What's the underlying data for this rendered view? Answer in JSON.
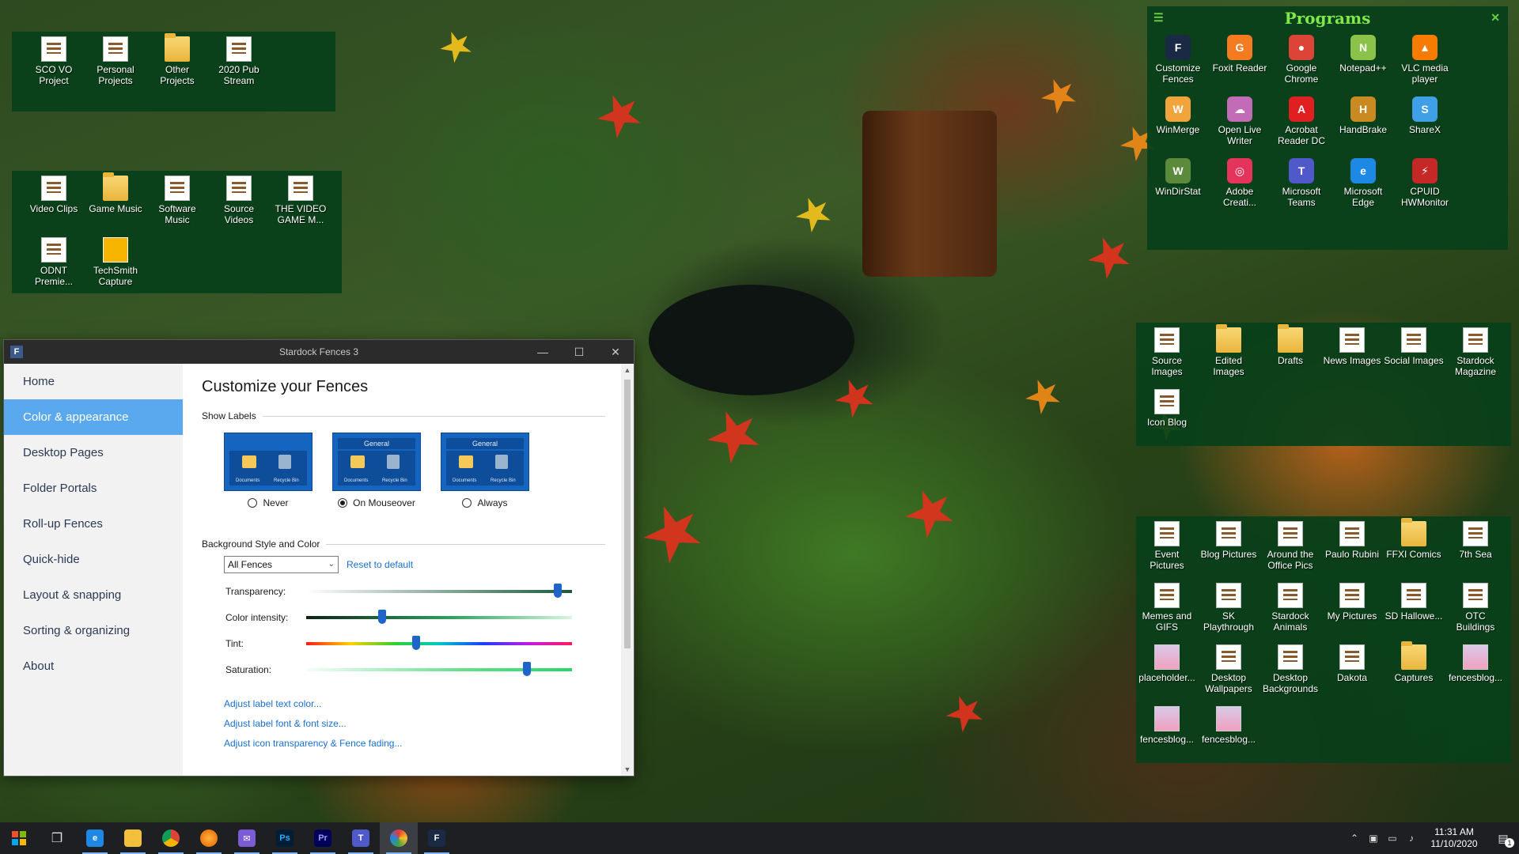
{
  "fences": {
    "top_left": [
      {
        "label": "SCO VO Project",
        "icon": "doc"
      },
      {
        "label": "Personal Projects",
        "icon": "doc"
      },
      {
        "label": "Other Projects",
        "icon": "folder"
      },
      {
        "label": "2020 Pub Stream",
        "icon": "doc"
      }
    ],
    "media": [
      {
        "label": "Video Clips",
        "icon": "doc"
      },
      {
        "label": "Game Music",
        "icon": "folder"
      },
      {
        "label": "Software Music",
        "icon": "doc"
      },
      {
        "label": "Source Videos",
        "icon": "doc"
      },
      {
        "label": "THE VIDEO GAME M...",
        "icon": "doc"
      },
      {
        "label": "ODNT Premie...",
        "icon": "doc"
      },
      {
        "label": "TechSmith Capture",
        "icon": "techsmith"
      }
    ],
    "programs": {
      "title": "Programs",
      "items": [
        {
          "label": "Customize Fences",
          "icon": "fences",
          "color": "#1b2a44",
          "glyph": "F"
        },
        {
          "label": "Foxit Reader",
          "icon": "foxit",
          "color": "#f47b20",
          "glyph": "G"
        },
        {
          "label": "Google Chrome",
          "icon": "chrome",
          "color": "#db4437",
          "glyph": "●"
        },
        {
          "label": "Notepad++",
          "icon": "notepad",
          "color": "#8bc34a",
          "glyph": "N"
        },
        {
          "label": "VLC media player",
          "icon": "vlc",
          "color": "#f57c00",
          "glyph": "▲"
        },
        {
          "label": "WinMerge",
          "icon": "winmerge",
          "color": "#f2a43c",
          "glyph": "W"
        },
        {
          "label": "Open Live Writer",
          "icon": "olw",
          "color": "#c26cb7",
          "glyph": "☁"
        },
        {
          "label": "Acrobat Reader DC",
          "icon": "acrobat",
          "color": "#e02020",
          "glyph": "A"
        },
        {
          "label": "HandBrake",
          "icon": "handbrake",
          "color": "#c98a22",
          "glyph": "H"
        },
        {
          "label": "ShareX",
          "icon": "sharex",
          "color": "#3fa0e8",
          "glyph": "S"
        },
        {
          "label": "WinDirStat",
          "icon": "windirstat",
          "color": "#5a8a3a",
          "glyph": "W"
        },
        {
          "label": "Adobe Creati...",
          "icon": "adobe-cc",
          "color": "#e5345b",
          "glyph": "◎"
        },
        {
          "label": "Microsoft Teams",
          "icon": "teams",
          "color": "#5059c9",
          "glyph": "T"
        },
        {
          "label": "Microsoft Edge",
          "icon": "edge",
          "color": "#1e88e5",
          "glyph": "e"
        },
        {
          "label": "CPUID HWMonitor",
          "icon": "hwmonitor",
          "color": "#c62828",
          "glyph": "⚡"
        }
      ]
    },
    "images": [
      {
        "label": "Source Images",
        "icon": "doc"
      },
      {
        "label": "Edited Images",
        "icon": "folder"
      },
      {
        "label": "Drafts",
        "icon": "folder"
      },
      {
        "label": "News Images",
        "icon": "doc"
      },
      {
        "label": "Social Images",
        "icon": "doc"
      },
      {
        "label": "Stardock Magazine",
        "icon": "doc"
      },
      {
        "label": "Icon Blog",
        "icon": "doc"
      }
    ],
    "pictures": [
      {
        "label": "Event Pictures",
        "icon": "doc"
      },
      {
        "label": "Blog Pictures",
        "icon": "doc"
      },
      {
        "label": "Around the Office Pics",
        "icon": "doc"
      },
      {
        "label": "Paulo Rubini",
        "icon": "doc"
      },
      {
        "label": "FFXI Comics",
        "icon": "folder"
      },
      {
        "label": "7th Sea",
        "icon": "doc"
      },
      {
        "label": "Memes and GIFS",
        "icon": "doc"
      },
      {
        "label": "SK Playthrough",
        "icon": "doc"
      },
      {
        "label": "Stardock Animals",
        "icon": "doc"
      },
      {
        "label": "My Pictures",
        "icon": "doc"
      },
      {
        "label": "SD Hallowe...",
        "icon": "doc"
      },
      {
        "label": "OTC Buildings",
        "icon": "doc"
      },
      {
        "label": "placeholder...",
        "icon": "image"
      },
      {
        "label": "Desktop Wallpapers",
        "icon": "doc"
      },
      {
        "label": "Desktop Backgrounds",
        "icon": "doc"
      },
      {
        "label": "Dakota",
        "icon": "doc"
      },
      {
        "label": "Captures",
        "icon": "folder"
      },
      {
        "label": "fencesblog...",
        "icon": "image"
      },
      {
        "label": "fencesblog...",
        "icon": "image"
      },
      {
        "label": "fencesblog...",
        "icon": "image"
      }
    ]
  },
  "window": {
    "title": "Stardock Fences 3",
    "nav": [
      "Home",
      "Color & appearance",
      "Desktop Pages",
      "Folder Portals",
      "Roll-up Fences",
      "Quick-hide",
      "Layout & snapping",
      "Sorting & organizing",
      "About"
    ],
    "active_nav_index": 1,
    "heading": "Customize your Fences",
    "show_labels": {
      "section": "Show Labels",
      "thumb_header": "General",
      "thumb_doc": "Documents",
      "thumb_bin": "Recycle Bin",
      "options": [
        "Never",
        "On Mouseover",
        "Always"
      ],
      "selected": "On Mouseover"
    },
    "background": {
      "section": "Background Style and Color",
      "select_value": "All Fences",
      "reset_link": "Reset to default",
      "sliders": [
        {
          "label": "Transparency:",
          "value": 0.96
        },
        {
          "label": "Color intensity:",
          "value": 0.28
        },
        {
          "label": "Tint:",
          "value": 0.41
        },
        {
          "label": "Saturation:",
          "value": 0.84
        }
      ]
    },
    "links": [
      "Adjust label text color...",
      "Adjust label font & font size...",
      "Adjust icon transparency & Fence fading..."
    ]
  },
  "taskbar": {
    "time": "11:31 AM",
    "date": "11/10/2020",
    "notification_count": "1"
  }
}
